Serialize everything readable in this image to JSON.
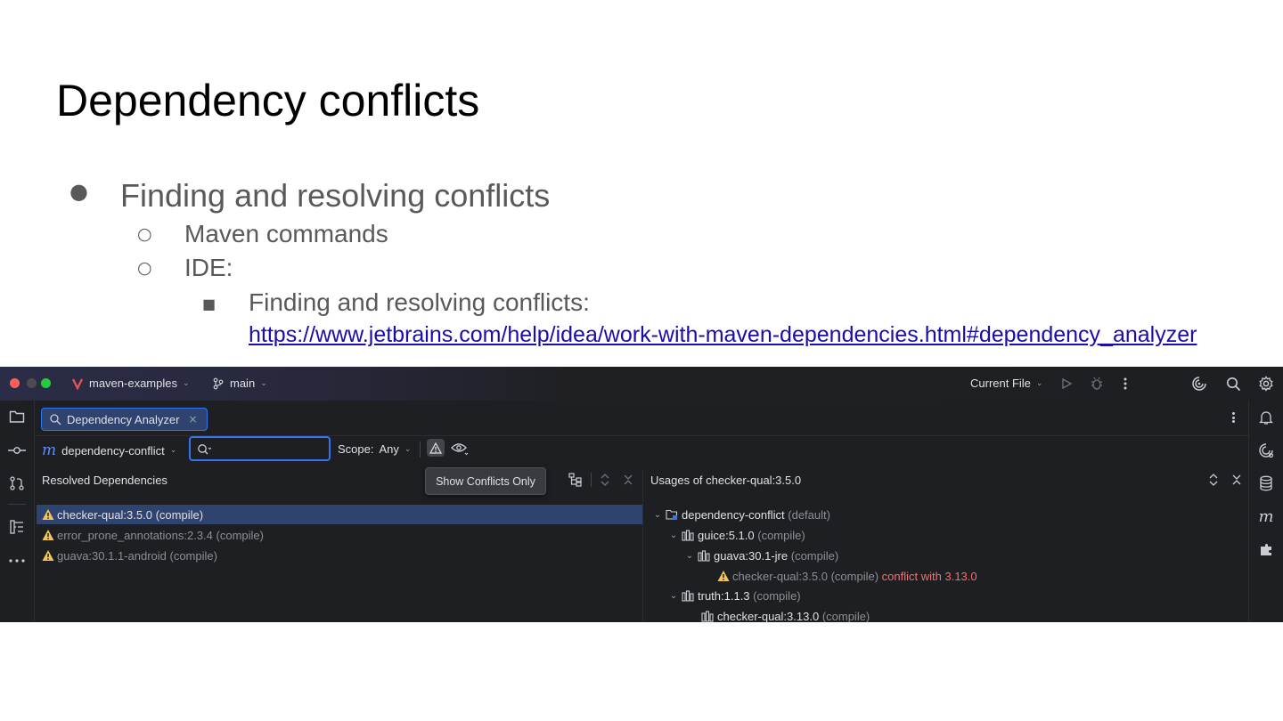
{
  "slide": {
    "title": "Dependency conflicts",
    "bullets": {
      "b1": "Finding and resolving conflicts",
      "b1_1": "Maven commands",
      "b1_2": "IDE:",
      "b1_2_1": "Finding and resolving conflicts:",
      "link": "https://www.jetbrains.com/help/idea/work-with-maven-dependencies.html#dependency_analyzer"
    },
    "bullet_glyphs": {
      "l1": "●",
      "l2": "○",
      "l3": "■"
    }
  },
  "ide": {
    "titlebar": {
      "project": "maven-examples",
      "branch": "main",
      "run_config": "Current File",
      "icons": [
        "run-icon",
        "debug-icon",
        "more-icon",
        "ai-assistant-icon",
        "search-icon",
        "settings-icon"
      ]
    },
    "left_toolbar_icons": [
      "project-icon",
      "commit-icon",
      "pull-requests-icon",
      "structure-icon",
      "more-tools-icon"
    ],
    "right_toolbar_icons": [
      "notifications-icon",
      "ai-chat-icon",
      "database-icon",
      "maven-icon",
      "plugins-icon"
    ],
    "tab": {
      "label": "Dependency Analyzer",
      "close": "×"
    },
    "toolbar": {
      "module": "dependency-conflict",
      "search_value": "",
      "scope_label": "Scope:",
      "scope_value": "Any",
      "tooltip": "Show Conflicts Only"
    },
    "left_pane": {
      "header": "Resolved Dependencies",
      "items": [
        {
          "name": "checker-qual:3.5.0",
          "scope": "(compile)",
          "selected": true
        },
        {
          "name": "error_prone_annotations:2.3.4",
          "scope": "(compile)",
          "selected": false
        },
        {
          "name": "guava:30.1.1-android",
          "scope": "(compile)",
          "selected": false
        }
      ]
    },
    "right_pane": {
      "header": "Usages of checker-qual:3.5.0",
      "tree": [
        {
          "name": "dependency-conflict",
          "scope": "(default)",
          "extra": ""
        },
        {
          "name": "guice:5.1.0",
          "scope": "(compile)",
          "extra": ""
        },
        {
          "name": "guava:30.1-jre",
          "scope": "(compile)",
          "extra": ""
        },
        {
          "name": "checker-qual:3.5.0",
          "scope": "(compile)",
          "extra": "conflict with 3.13.0"
        },
        {
          "name": "truth:1.1.3",
          "scope": "(compile)",
          "extra": ""
        },
        {
          "name": "checker-qual:3.13.0",
          "scope": "(compile)",
          "extra": ""
        }
      ]
    },
    "colors": {
      "accent": "#3574f0",
      "warning": "#f2c55c",
      "conflict": "#ff6b68",
      "selection": "#2e436e"
    }
  }
}
